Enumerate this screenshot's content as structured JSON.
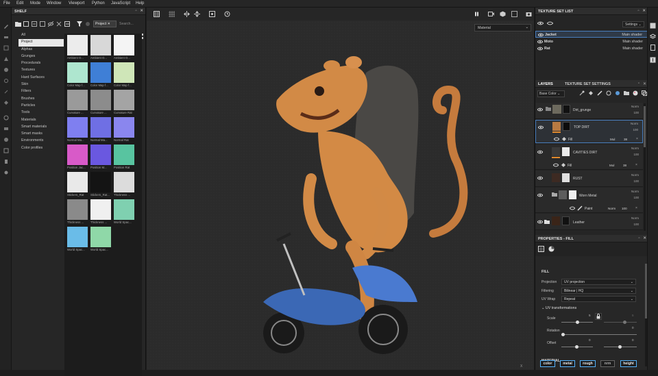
{
  "menu": [
    "File",
    "Edit",
    "Mode",
    "Window",
    "Viewport",
    "Python",
    "JavaScript",
    "Help"
  ],
  "shelf": {
    "title": "SHELF",
    "filter_chip": "Project",
    "search_placeholder": "Search...",
    "categories": [
      "All",
      "Project",
      "Alphas",
      "Grunges",
      "Procedurals",
      "Textures",
      "Hard Surfaces",
      "Skin",
      "Filters",
      "Brushes",
      "Particles",
      "Tools",
      "Materials",
      "Smart materials",
      "Smart masks",
      "Environments",
      "Color profiles"
    ],
    "selected_category": "Project",
    "thumbnails": [
      {
        "label": "Ambient O...",
        "color": "#ececec"
      },
      {
        "label": "Ambient O...",
        "color": "#d8d8d8"
      },
      {
        "label": "Ambient O...",
        "color": "#f4f4f4"
      },
      {
        "label": "Color Map f...",
        "color": "#aee6cf"
      },
      {
        "label": "Color Map f...",
        "color": "#3f7fd6"
      },
      {
        "label": "Color Map f...",
        "color": "#cfe6b8"
      },
      {
        "label": "Curvature ...",
        "color": "#9a9a9a"
      },
      {
        "label": "Curvature ...",
        "color": "#8c8c8c"
      },
      {
        "label": "Curvature Rat",
        "color": "#a4a4a4"
      },
      {
        "label": "Normal Ma...",
        "color": "#7f7ff0"
      },
      {
        "label": "Normal Ma...",
        "color": "#6f6fe4"
      },
      {
        "label": "Normal Rat",
        "color": "#8a86ee"
      },
      {
        "label": "Position Jac...",
        "color": "#d85ac8"
      },
      {
        "label": "Position M...",
        "color": "#6a58e0"
      },
      {
        "label": "Position Rat",
        "color": "#58c4a0"
      },
      {
        "label": "Stickers_Rat",
        "color": "#e9e9e9"
      },
      {
        "label": "Stickers_Rat...",
        "color": "#141414"
      },
      {
        "label": "Thickness ...",
        "color": "#dcdcdc"
      },
      {
        "label": "Thickness ...",
        "color": "#8a8a8a"
      },
      {
        "label": "Thickness ...",
        "color": "#f0f0f0"
      },
      {
        "label": "World Spac...",
        "color": "#7fd0b0"
      },
      {
        "label": "World Spac...",
        "color": "#6abce8"
      },
      {
        "label": "World Spac...",
        "color": "#8fd8a8"
      }
    ]
  },
  "viewport": {
    "material_mode": "Material",
    "axis_label": "X"
  },
  "texture_set_list": {
    "title": "TEXTURE SET LIST",
    "settings_label": "Settings",
    "sets": [
      {
        "name": "Jacket",
        "shader": "Main shader"
      },
      {
        "name": "Moto",
        "shader": "Main shader"
      },
      {
        "name": "Rat",
        "shader": "Main shader"
      }
    ]
  },
  "layers_panel": {
    "tab_layers": "LAYERS",
    "tab_settings": "TEXTURE SET SETTINGS",
    "channel": "Base Color",
    "layers": [
      {
        "name": "Dirt_grunge",
        "blend": "Norm",
        "opacity": "100"
      },
      {
        "name": "TOP DIRT",
        "blend": "Norm",
        "opacity": "100",
        "sub": "Fill",
        "sub_blend": "Mul",
        "sub_opacity": "38"
      },
      {
        "name": "CAVITIES DIRT",
        "blend": "Norm",
        "opacity": "100",
        "sub": "Fill",
        "sub_blend": "Mul",
        "sub_opacity": "38"
      },
      {
        "name": "RUST",
        "blend": "Norm",
        "opacity": "100"
      },
      {
        "name": "Worn Metal",
        "blend": "Norm",
        "opacity": "100",
        "sub": "Paint",
        "sub_blend": "Norm",
        "sub_opacity": "100"
      },
      {
        "name": "Leather",
        "blend": "Norm",
        "opacity": "100"
      }
    ]
  },
  "properties": {
    "title": "PROPERTIES - FILL",
    "section_fill": "FILL",
    "projection_label": "Projection",
    "projection_value": "UV projection",
    "filtering_label": "Filtering",
    "filtering_value": "Bilinear | HQ",
    "uvwrap_label": "UV Wrap",
    "uvwrap_value": "Repeat",
    "uv_transformations": "UV transformations",
    "scale_label": "Scale",
    "scale_value": "5",
    "scale_value2": "5",
    "scale_level": 0.5,
    "rotation_label": "Rotation",
    "rotation_value": "0",
    "offset_label": "Offset",
    "offset_value": "0",
    "offset_value2": "0",
    "section_material": "MATERIAL",
    "channels": [
      "color",
      "metal",
      "rough",
      "nrm",
      "height"
    ]
  }
}
